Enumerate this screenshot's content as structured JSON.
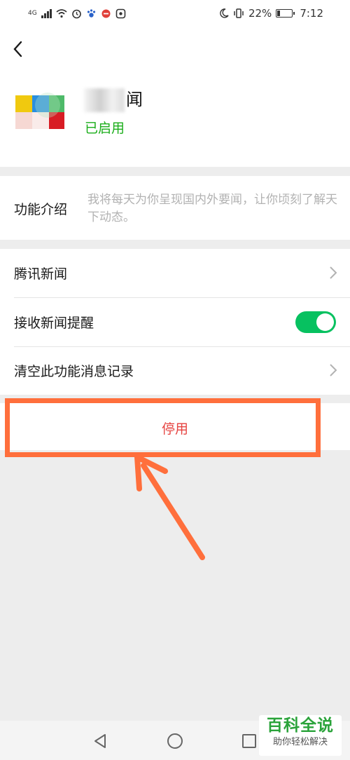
{
  "status_bar": {
    "network": "4G",
    "battery_percent": "22%",
    "battery_level": 0.22,
    "time": "7:12"
  },
  "header": {
    "app_name_visible": "闻",
    "app_status": "已启用"
  },
  "intro": {
    "label": "功能介绍",
    "text": "我将每天为你呈现国内外要闻，让你顷刻了解天下动态。"
  },
  "settings": {
    "rows": [
      {
        "label": "腾讯新闻"
      },
      {
        "label": "接收新闻提醒",
        "toggle_on": true
      },
      {
        "label": "清空此功能消息记录"
      }
    ]
  },
  "disable_button": {
    "label": "停用"
  },
  "watermark": {
    "title": "百科全说",
    "subtitle": "助你轻松解决"
  },
  "colors": {
    "accent_green": "#07c160",
    "status_green": "#1aad19",
    "danger_red": "#e64340",
    "annotation_orange": "#ff6f3c"
  },
  "icons": {
    "back": "back-arrow-icon",
    "chevron": "chevron-right-icon",
    "nav_back": "triangle-back-icon",
    "nav_home": "circle-home-icon",
    "nav_recent": "square-recent-icon"
  }
}
